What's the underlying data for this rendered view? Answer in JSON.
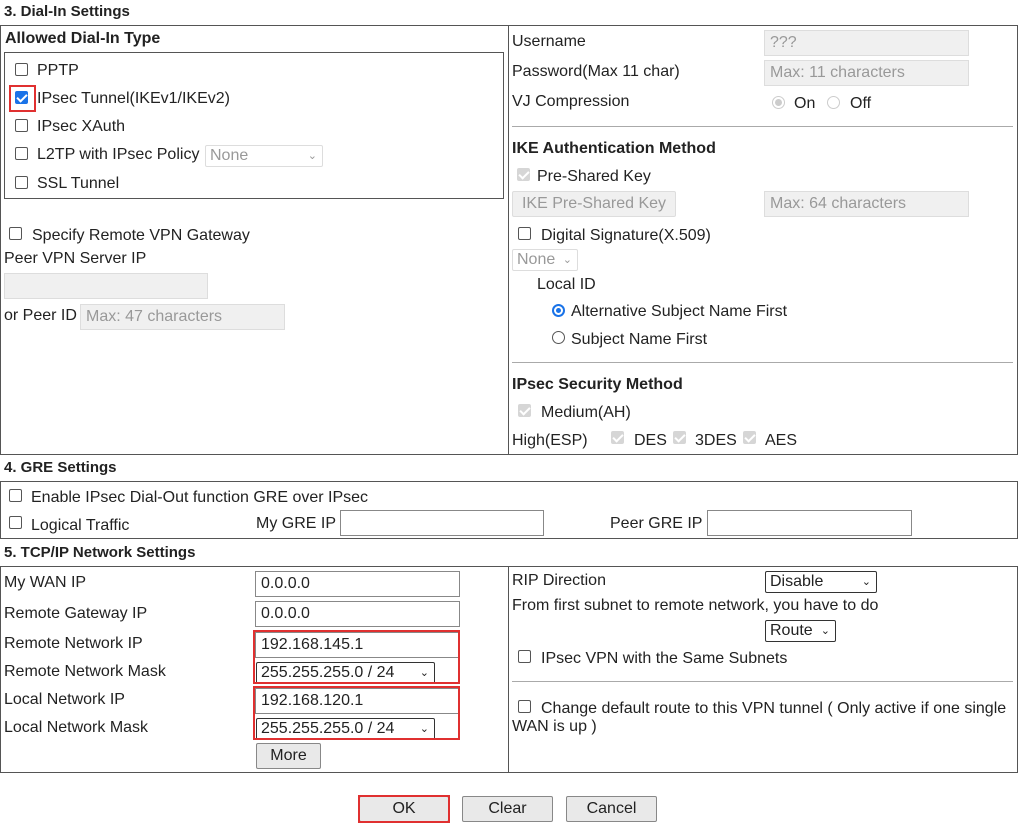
{
  "sections": {
    "dial_in": "3. Dial-In Settings",
    "gre": "4. GRE Settings",
    "tcpip": "5. TCP/IP Network Settings"
  },
  "dial_in": {
    "allowed_header": "Allowed Dial-In Type",
    "types": [
      {
        "label": "PPTP",
        "checked": false
      },
      {
        "label": "IPsec Tunnel(IKEv1/IKEv2)",
        "checked": true
      },
      {
        "label": "IPsec XAuth",
        "checked": false
      },
      {
        "label": "L2TP with IPsec Policy",
        "checked": false
      },
      {
        "label": "SSL Tunnel",
        "checked": false
      }
    ],
    "l2tp_policy_value": "None",
    "specify_gateway_label": "Specify Remote VPN Gateway",
    "peer_server_ip_label": "Peer VPN Server IP",
    "peer_id_label": "or Peer ID",
    "peer_id_placeholder": "Max: 47 characters",
    "username_label": "Username",
    "username_value": "???",
    "password_label": "Password(Max 11 char)",
    "password_placeholder": "Max: 11 characters",
    "vj_label": "VJ Compression",
    "vj_on": "On",
    "vj_off": "Off",
    "ike_header": "IKE Authentication Method",
    "psk_label": "Pre-Shared Key",
    "ike_psk_button": "IKE Pre-Shared Key",
    "psk_placeholder": "Max: 64 characters",
    "digital_sig_label": "Digital Signature(X.509)",
    "digital_sig_value": "None",
    "local_id_label": "Local ID",
    "alt_subject_label": "Alternative Subject Name First",
    "subject_label": "Subject Name First",
    "ipsec_sec_header": "IPsec Security Method",
    "medium_label": "Medium(AH)",
    "high_label": "High(ESP)",
    "des_label": "DES",
    "tdes_label": "3DES",
    "aes_label": "AES"
  },
  "gre": {
    "enable_label": "Enable IPsec Dial-Out function GRE over IPsec",
    "logical_label": "Logical Traffic",
    "my_gre_label": "My GRE IP",
    "peer_gre_label": "Peer GRE IP"
  },
  "tcpip": {
    "my_wan_label": "My WAN IP",
    "my_wan_value": "0.0.0.0",
    "remote_gw_label": "Remote Gateway IP",
    "remote_gw_value": "0.0.0.0",
    "remote_net_ip_label": "Remote Network IP",
    "remote_net_ip_value": "192.168.145.1",
    "remote_mask_label": "Remote Network Mask",
    "remote_mask_value": "255.255.255.0 / 24",
    "local_net_ip_label": "Local Network IP",
    "local_net_ip_value": "192.168.120.1",
    "local_mask_label": "Local Network Mask",
    "local_mask_value": "255.255.255.0 / 24",
    "more_button": "More",
    "rip_label": "RIP Direction",
    "rip_value": "Disable",
    "first_subnet_label": "From first subnet to remote network, you have to do",
    "route_value": "Route",
    "same_subnets_label": "IPsec VPN with the Same Subnets",
    "change_route_label": "Change default route to this VPN tunnel ( Only active if one single WAN is up )"
  },
  "footer": {
    "ok": "OK",
    "clear": "Clear",
    "cancel": "Cancel"
  },
  "colors": {
    "highlight": "#e03030",
    "accent": "#1a73e8"
  }
}
